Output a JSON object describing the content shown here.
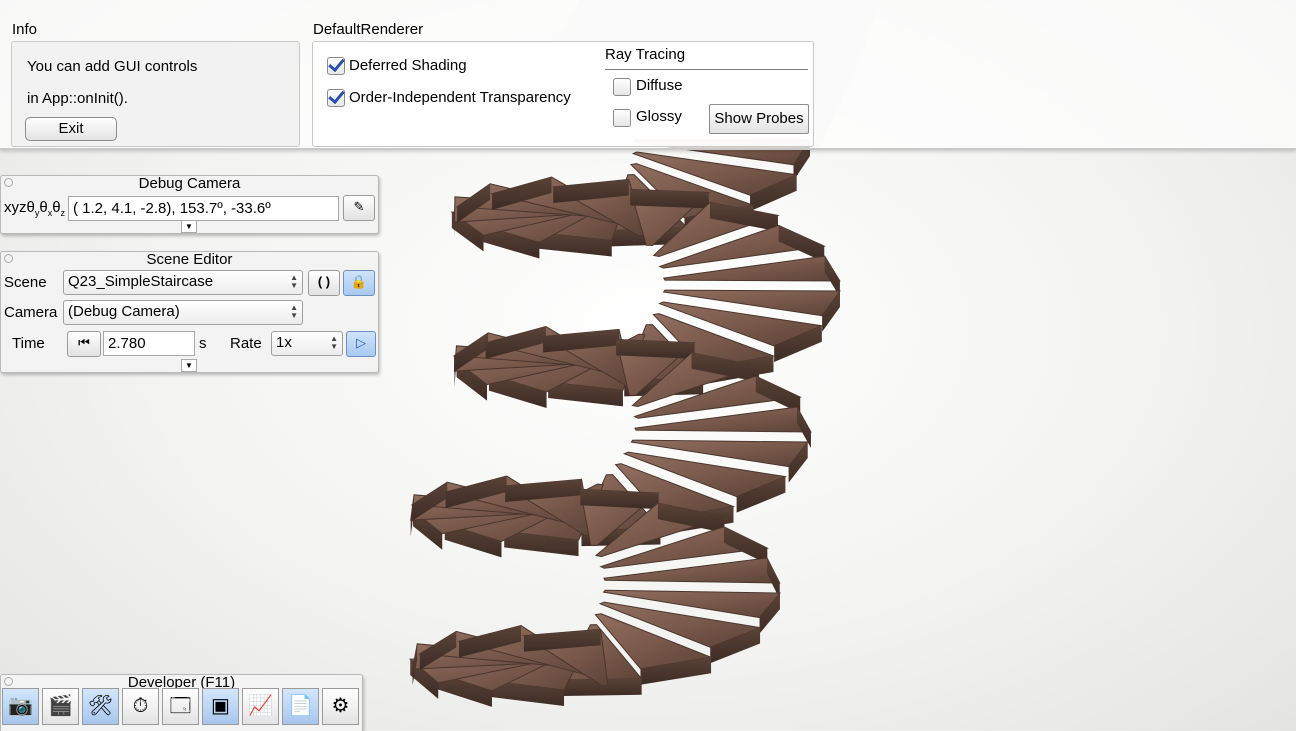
{
  "info_panel": {
    "title": "Info",
    "line1": "You can add GUI controls",
    "line2": "in App::onInit().",
    "exit_button": "Exit"
  },
  "renderer_panel": {
    "title": "DefaultRenderer",
    "deferred_shading": {
      "label": "Deferred Shading",
      "checked": true
    },
    "oit": {
      "label": "Order-Independent Transparency",
      "checked": true
    },
    "ray_tracing": {
      "title": "Ray Tracing",
      "diffuse": {
        "label": "Diffuse",
        "checked": false
      },
      "glossy": {
        "label": "Glossy",
        "checked": false
      },
      "show_probes_button": "Show Probes"
    }
  },
  "debug_camera": {
    "title": "Debug Camera",
    "label": "xyzθₓθᵧθₓ",
    "label_display": "xyzθyθxθz",
    "value": " ( 1.2,   4.1,  -2.8),  153.7º, -33.6º"
  },
  "scene_editor": {
    "title": "Scene Editor",
    "scene_label": "Scene",
    "scene_value": "Q23_SimpleStaircase",
    "camera_label": "Camera",
    "camera_value": "(Debug Camera)",
    "time_label": "Time",
    "time_value": "2.780",
    "time_unit": "s",
    "rate_label": "Rate",
    "rate_value": "1x"
  },
  "developer": {
    "title": "Developer (F11)",
    "tools": [
      {
        "icon": "camera-icon",
        "glyph": "📷",
        "active": true
      },
      {
        "icon": "clapperboard-icon",
        "glyph": "🎬",
        "active": false
      },
      {
        "icon": "tools-icon",
        "glyph": "🛠",
        "active": true
      },
      {
        "icon": "clock-icon",
        "glyph": "⏱",
        "active": false
      },
      {
        "icon": "window-icon",
        "glyph": "🗔",
        "active": false
      },
      {
        "icon": "scene-layout-icon",
        "glyph": "▣",
        "active": true
      },
      {
        "icon": "profiler-icon",
        "glyph": "📈",
        "active": false
      },
      {
        "icon": "log-icon",
        "glyph": "📄",
        "active": true
      },
      {
        "icon": "gear-icon",
        "glyph": "⚙",
        "active": false
      }
    ]
  },
  "colors": {
    "wood": "#7a5a4c",
    "wood_dark": "#4f3a31",
    "accent_blue": "#2b4fa8"
  }
}
